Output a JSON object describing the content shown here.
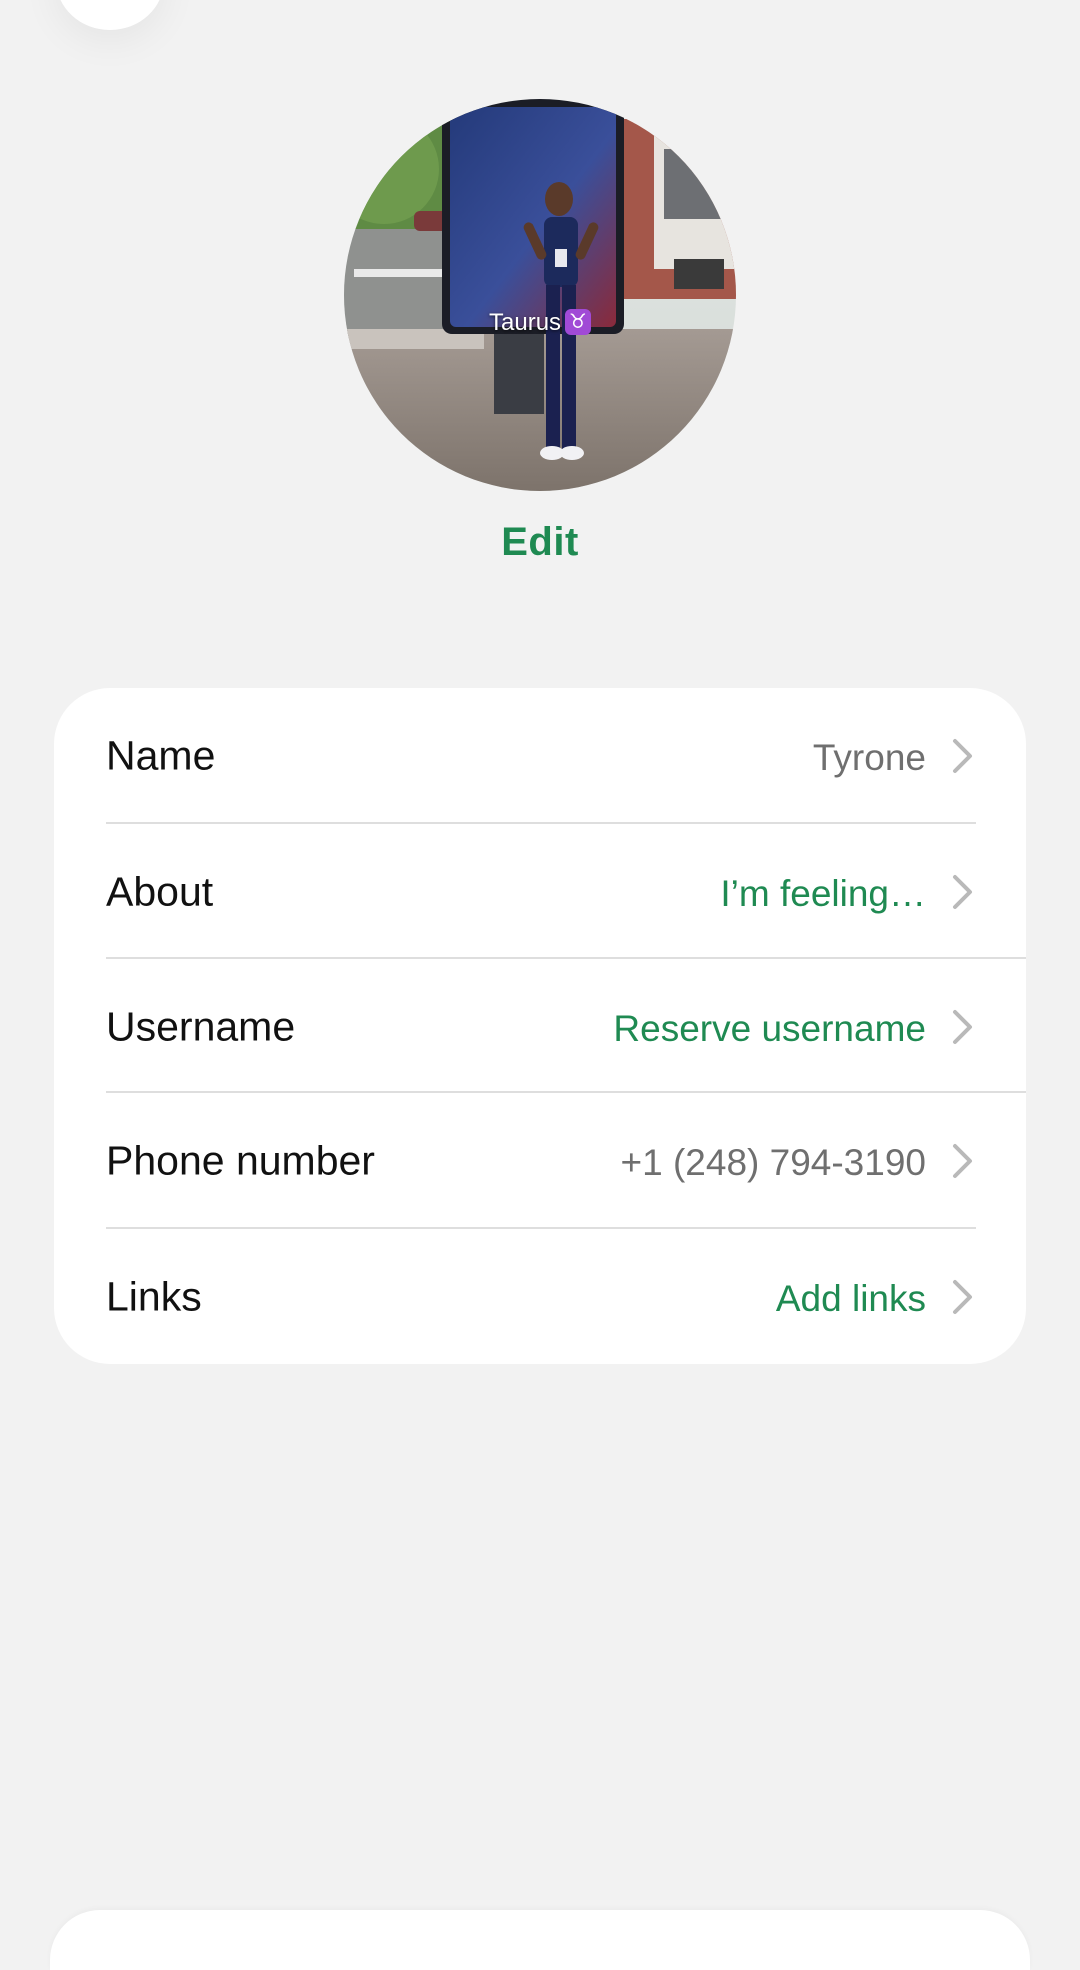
{
  "profile": {
    "avatar_caption": "Taurus",
    "zodiac_symbol": "♉",
    "edit_label": "Edit"
  },
  "rows": [
    {
      "label": "Name",
      "value": "Tyrone",
      "value_style": "muted"
    },
    {
      "label": "About",
      "value": "I’m feeling…",
      "value_style": "accent"
    },
    {
      "label": "Username",
      "value": "Reserve username",
      "value_style": "accent"
    },
    {
      "label": "Phone number",
      "value": "+1 (248) 794-3190",
      "value_style": "muted"
    },
    {
      "label": "Links",
      "value": "Add links",
      "value_style": "accent"
    }
  ],
  "icons": {
    "row_trailing": "chevron-right-icon",
    "back": "back-icon"
  },
  "colors": {
    "background": "#f2f2f2",
    "card": "#ffffff",
    "accent": "#1f8a52",
    "muted_text": "#6f6f6f",
    "primary_text": "#111111",
    "zodiac_badge": "#a14ad6"
  }
}
